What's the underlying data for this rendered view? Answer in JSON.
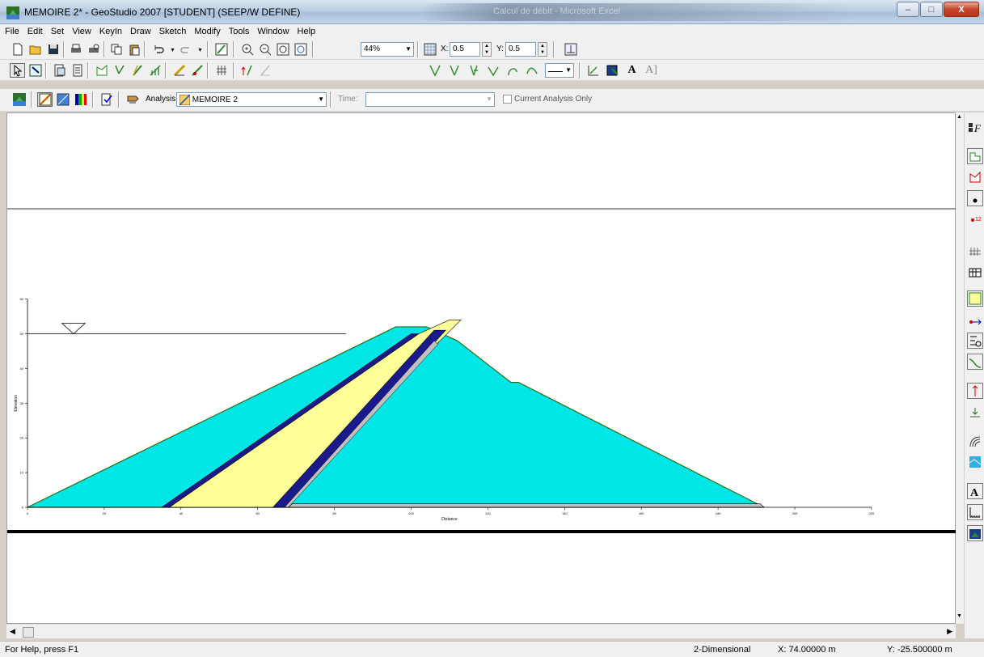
{
  "window": {
    "title": "MEMOIRE 2* - GeoStudio 2007 [STUDENT] (SEEP/W DEFINE)",
    "background_task": "Calcul de débit - Microsoft Excel",
    "minimize": "–",
    "maximize": "□",
    "close": "X"
  },
  "menu": [
    "File",
    "Edit",
    "Set",
    "View",
    "KeyIn",
    "Draw",
    "Sketch",
    "Modify",
    "Tools",
    "Window",
    "Help"
  ],
  "toolbar1": {
    "zoom": "44%",
    "x_label": "X:",
    "x_value": "0.5",
    "y_label": "Y:",
    "y_value": "0.5"
  },
  "toolbar3": {
    "analysis_label": "Analysis:",
    "analysis_value": "MEMOIRE 2",
    "time_label": "Time:",
    "time_value": "",
    "current_only_label": "Current Analysis Only"
  },
  "plot": {
    "x_axis_label": "Distance",
    "y_axis_label": "Elevation",
    "x_ticks": [
      "0",
      "20",
      "40",
      "60",
      "80",
      "100",
      "120",
      "140",
      "160",
      "180",
      "200",
      "220"
    ],
    "y_ticks": [
      "0",
      "10",
      "20",
      "30",
      "40",
      "50",
      "60"
    ],
    "x_range": [
      0,
      220
    ],
    "y_range": [
      0,
      60
    ],
    "colors": {
      "shell": "#00e6e6",
      "filter": "#ffff99",
      "drain": "#1a1a8c",
      "outline": "#2e6b0f",
      "base_drain": "#c0c0c0"
    }
  },
  "status": {
    "help": "For Help, press F1",
    "mode": "2-Dimensional",
    "x": "X: 74.00000 m",
    "y": "Y: -25.500000 m"
  }
}
